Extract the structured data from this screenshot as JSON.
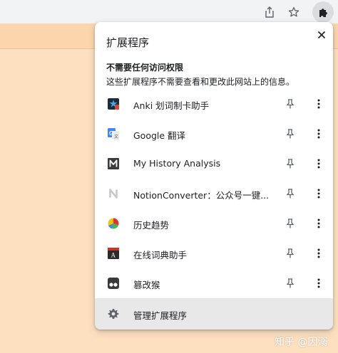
{
  "popup": {
    "title": "扩展程序",
    "section_heading": "不需要任何访问权限",
    "section_desc": "这些扩展程序不需要查看和更改此网站上的信息。",
    "manage_label": "管理扩展程序"
  },
  "extensions": [
    {
      "name": "Anki 划词制卡助手",
      "icon": "anki-icon"
    },
    {
      "name": "Google 翻译",
      "icon": "google-translate-icon"
    },
    {
      "name": "My History Analysis",
      "icon": "history-m-icon"
    },
    {
      "name": "NotionConverter：公众号一键...",
      "icon": "notion-icon"
    },
    {
      "name": "历史趋势",
      "icon": "pie-trend-icon"
    },
    {
      "name": "在线词典助手",
      "icon": "dictionary-icon"
    },
    {
      "name": "篡改猴",
      "icon": "tampermonkey-icon"
    }
  ],
  "watermark": "知乎 @因溺",
  "colors": {
    "page_bg": "#fde0bf",
    "toolbar_bg": "#f1f3f4",
    "manage_row_bg": "#e8e8e8",
    "icon_gray": "#5f6368"
  }
}
